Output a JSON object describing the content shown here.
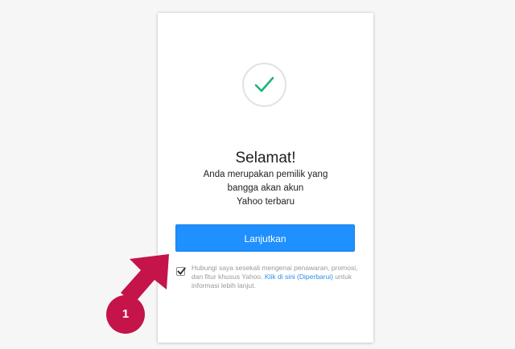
{
  "card": {
    "success_icon": "checkmark-icon",
    "title": "Selamat!",
    "subtitle_lines": [
      "Anda merupakan pemilik yang",
      "bangga akan akun",
      "Yahoo terbaru"
    ],
    "continue_label": "Lanjutkan",
    "consent": {
      "checked": true,
      "text_before": "Hubungi saya sesekali mengenai penawaran, promosi, dan fitur khusus Yahoo.",
      "link_text": "Klik di sini (Diperbarui)",
      "text_after": "untuk informasi lebih lanjut."
    }
  },
  "annotation": {
    "badge_number": "1",
    "color": "#c4144a",
    "arrow_icon": "arrow-pointer-icon"
  },
  "colors": {
    "accent": "#1e90ff",
    "check": "#1cb577",
    "link": "#2d8fe6",
    "background": "#f6f6f6"
  }
}
